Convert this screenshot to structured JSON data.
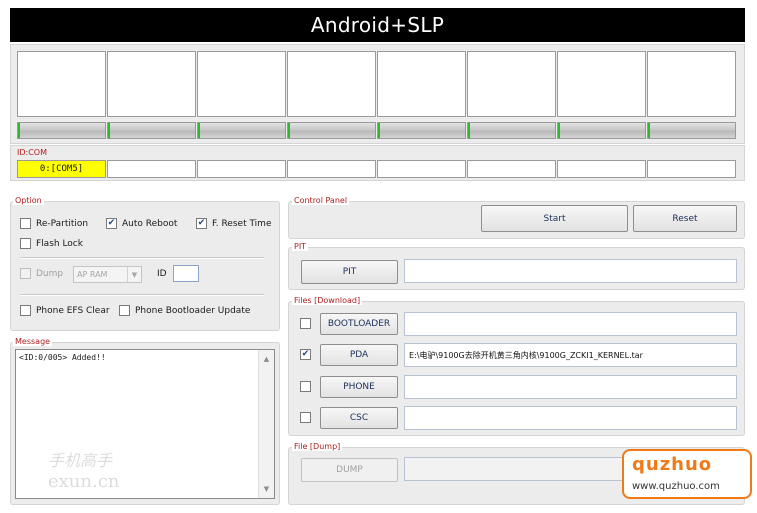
{
  "window": {
    "title": "Android+SLP"
  },
  "ports": {
    "count": 8
  },
  "idcom": {
    "label": "ID:COM",
    "cells": [
      "0:[COM5]",
      "",
      "",
      "",
      "",
      "",
      "",
      ""
    ]
  },
  "option": {
    "label": "Option",
    "re_partition": {
      "label": "Re-Partition",
      "checked": false
    },
    "auto_reboot": {
      "label": "Auto Reboot",
      "checked": true
    },
    "f_reset_time": {
      "label": "F. Reset Time",
      "checked": true
    },
    "flash_lock": {
      "label": "Flash Lock",
      "checked": false
    },
    "dump": {
      "label": "Dump",
      "checked": false
    },
    "dump_select": "AP RAM",
    "id_label": "ID",
    "phone_efs_clear": {
      "label": "Phone EFS Clear",
      "checked": false
    },
    "phone_bootloader_update": {
      "label": "Phone Bootloader Update",
      "checked": false
    }
  },
  "message": {
    "label": "Message",
    "text": "<ID:0/005> Added!!"
  },
  "control_panel": {
    "label": "Control Panel",
    "start": "Start",
    "reset": "Reset"
  },
  "pit": {
    "label": "PIT",
    "button": "PIT",
    "path": ""
  },
  "files": {
    "label": "Files [Download]",
    "items": [
      {
        "button": "BOOTLOADER",
        "checked": false,
        "path": ""
      },
      {
        "button": "PDA",
        "checked": true,
        "path": "E:\\电驴\\9100G去除开机黄三角内核\\9100G_ZCKI1_KERNEL.tar"
      },
      {
        "button": "PHONE",
        "checked": false,
        "path": ""
      },
      {
        "button": "CSC",
        "checked": false,
        "path": ""
      }
    ]
  },
  "dump_group": {
    "label": "File [Dump]",
    "button": "DUMP",
    "path": ""
  },
  "watermarks": {
    "left_top": "手机高手",
    "left_bottom": "exun.cn",
    "right_logo": "quzhuo",
    "right_url": "www.quzhuo.com"
  },
  "colors": {
    "active_port": "#ffff00",
    "label_red": "#b02020",
    "progress_green": "#2eb82e"
  }
}
